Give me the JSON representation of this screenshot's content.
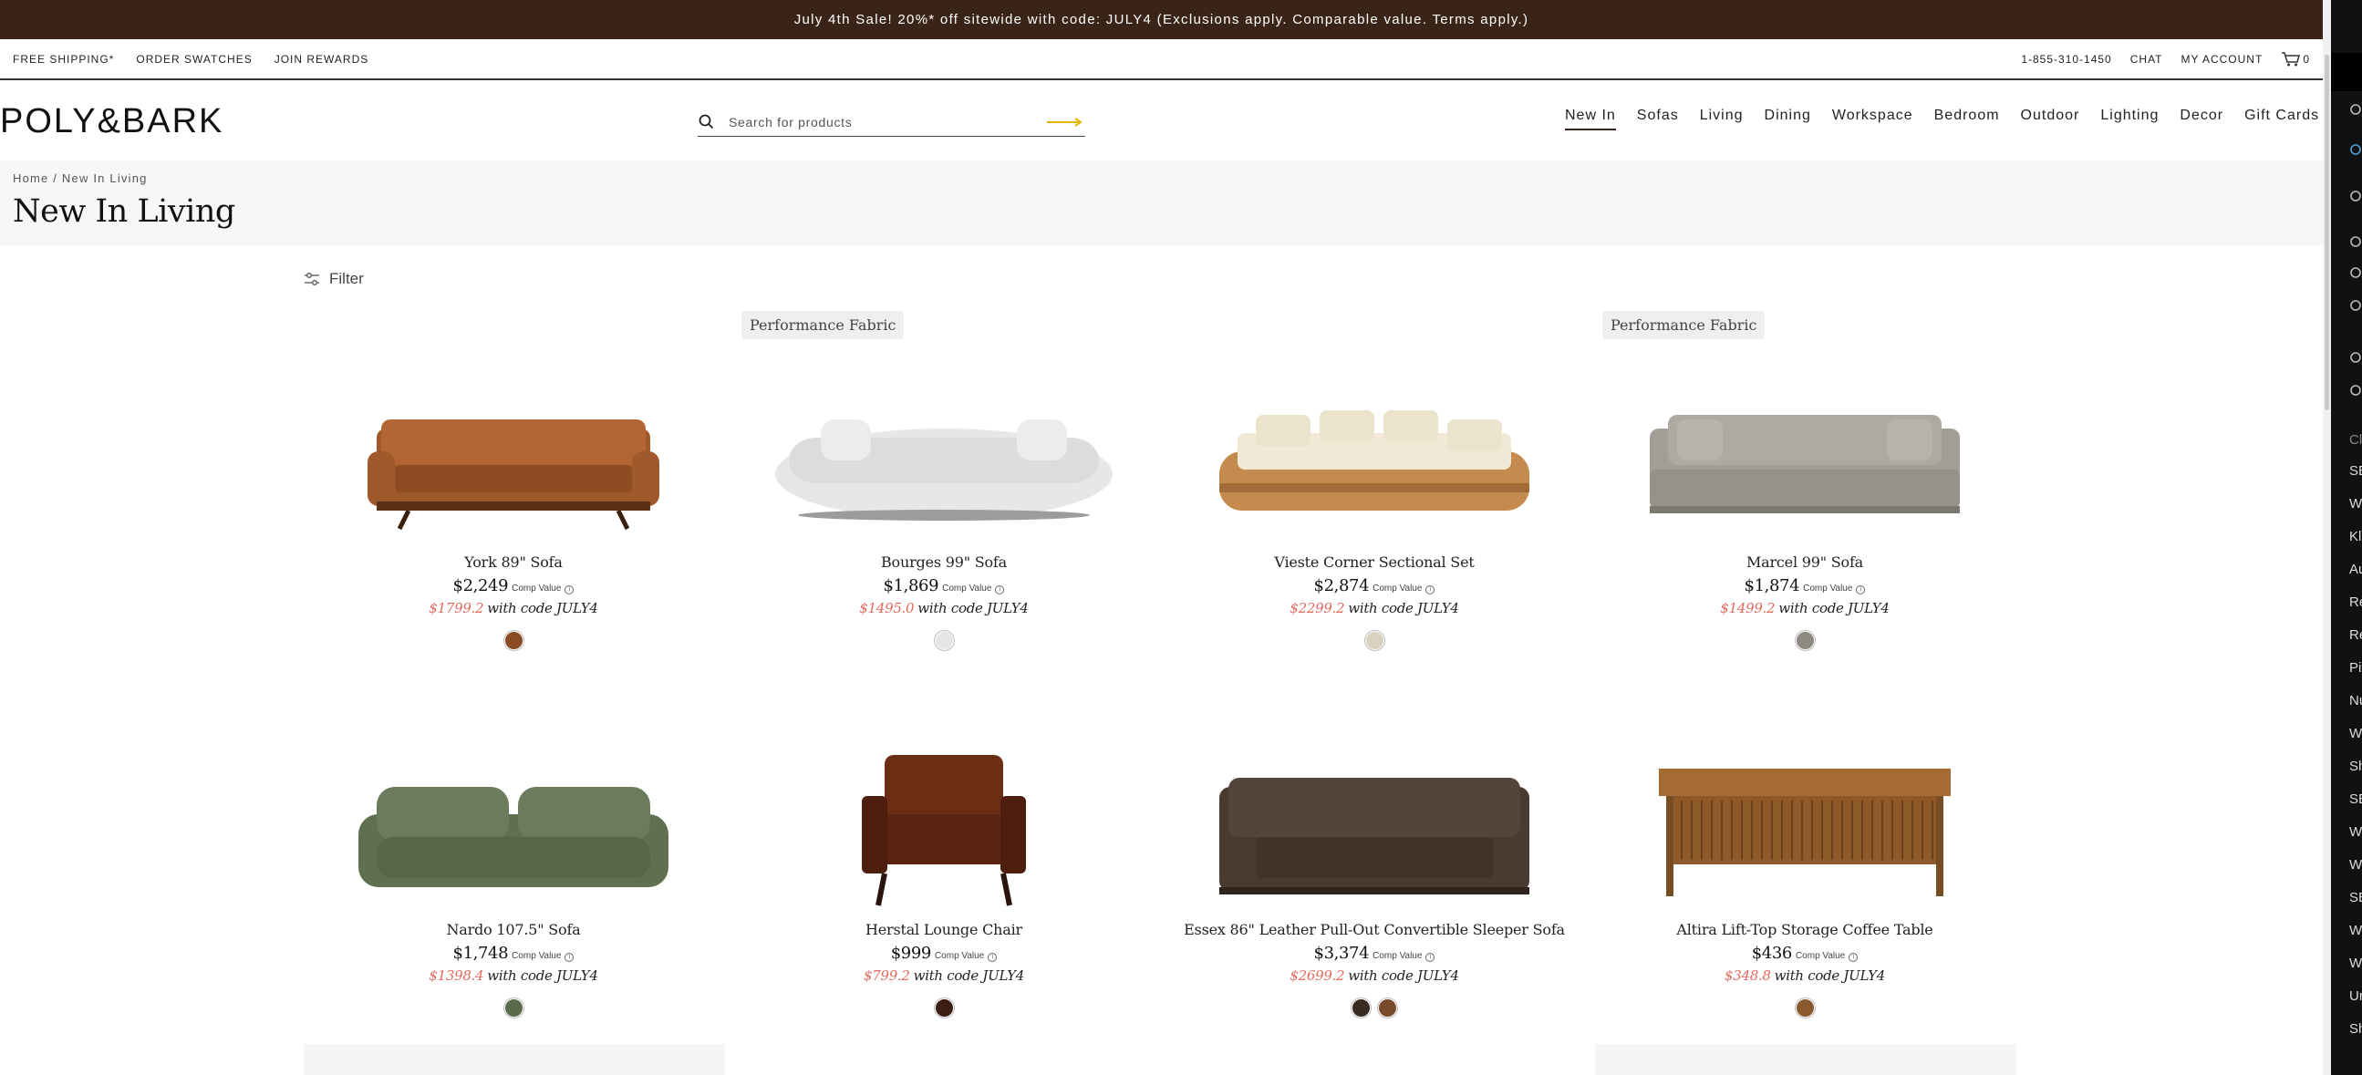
{
  "promo": {
    "text": "July 4th Sale! 20%* off sitewide with code: JULY4 (Exclusions apply. Comparable value. Terms apply.)"
  },
  "utility": {
    "free_shipping": "FREE SHIPPING*",
    "order_swatches": "ORDER SWATCHES",
    "join_rewards": "JOIN REWARDS",
    "phone": "1-855-310-1450",
    "chat": "CHAT",
    "my_account": "MY ACCOUNT",
    "cart_count": "0"
  },
  "brand": {
    "logo": "POLY&BARK"
  },
  "search": {
    "placeholder": "Search for products",
    "value": ""
  },
  "nav": {
    "items": [
      "New In",
      "Sofas",
      "Living",
      "Dining",
      "Workspace",
      "Bedroom",
      "Outdoor",
      "Lighting",
      "Decor",
      "Gift Cards"
    ],
    "active": "New In"
  },
  "breadcrumb": {
    "home": "Home",
    "separator": "/",
    "current": "New In Living"
  },
  "page": {
    "title": "New In Living"
  },
  "filter": {
    "label": "Filter"
  },
  "product_common": {
    "comp_value": "Comp Value",
    "with_code": "with code JULY4"
  },
  "products": [
    {
      "badge": "",
      "name": "York 89\" Sofa",
      "price": "$2,249",
      "sale_price": "$1799.2",
      "swatches": [
        "#8a4a24"
      ]
    },
    {
      "badge": "Performance Fabric",
      "name": "Bourges 99\" Sofa",
      "price": "$1,869",
      "sale_price": "$1495.0",
      "swatches": [
        "#e6e6e6"
      ]
    },
    {
      "badge": "",
      "name": "Vieste Corner Sectional Set",
      "price": "$2,874",
      "sale_price": "$2299.2",
      "swatches": [
        "#d8d2bf"
      ]
    },
    {
      "badge": "Performance Fabric",
      "name": "Marcel 99\" Sofa",
      "price": "$1,874",
      "sale_price": "$1499.2",
      "swatches": [
        "#8d8980"
      ]
    },
    {
      "badge": "",
      "name": "Nardo 107.5\" Sofa",
      "price": "$1,748",
      "sale_price": "$1398.4",
      "swatches": [
        "#5a6b4c"
      ]
    },
    {
      "badge": "",
      "name": "Herstal Lounge Chair",
      "price": "$999",
      "sale_price": "$799.2",
      "swatches": [
        "#3b1d12"
      ]
    },
    {
      "badge": "",
      "name": "Essex 86\" Leather Pull-Out Convertible Sleeper Sofa",
      "price": "$3,374",
      "sale_price": "$2699.2",
      "swatches": [
        "#3a2a22",
        "#7a4a2a"
      ]
    },
    {
      "badge": "",
      "name": "Altira Lift-Top Storage Coffee Table",
      "price": "$436",
      "sale_price": "$348.8",
      "swatches": [
        "#8a5a2e"
      ]
    }
  ],
  "side_panel": {
    "items": [
      "SE",
      "W",
      "Kl",
      "Au",
      "Re",
      "Re",
      "Pi",
      "Nu",
      "W",
      "Sh",
      "SE",
      "W",
      "W",
      "SE",
      "W",
      "W",
      "Ur",
      "Sh"
    ],
    "section": "Cl"
  }
}
